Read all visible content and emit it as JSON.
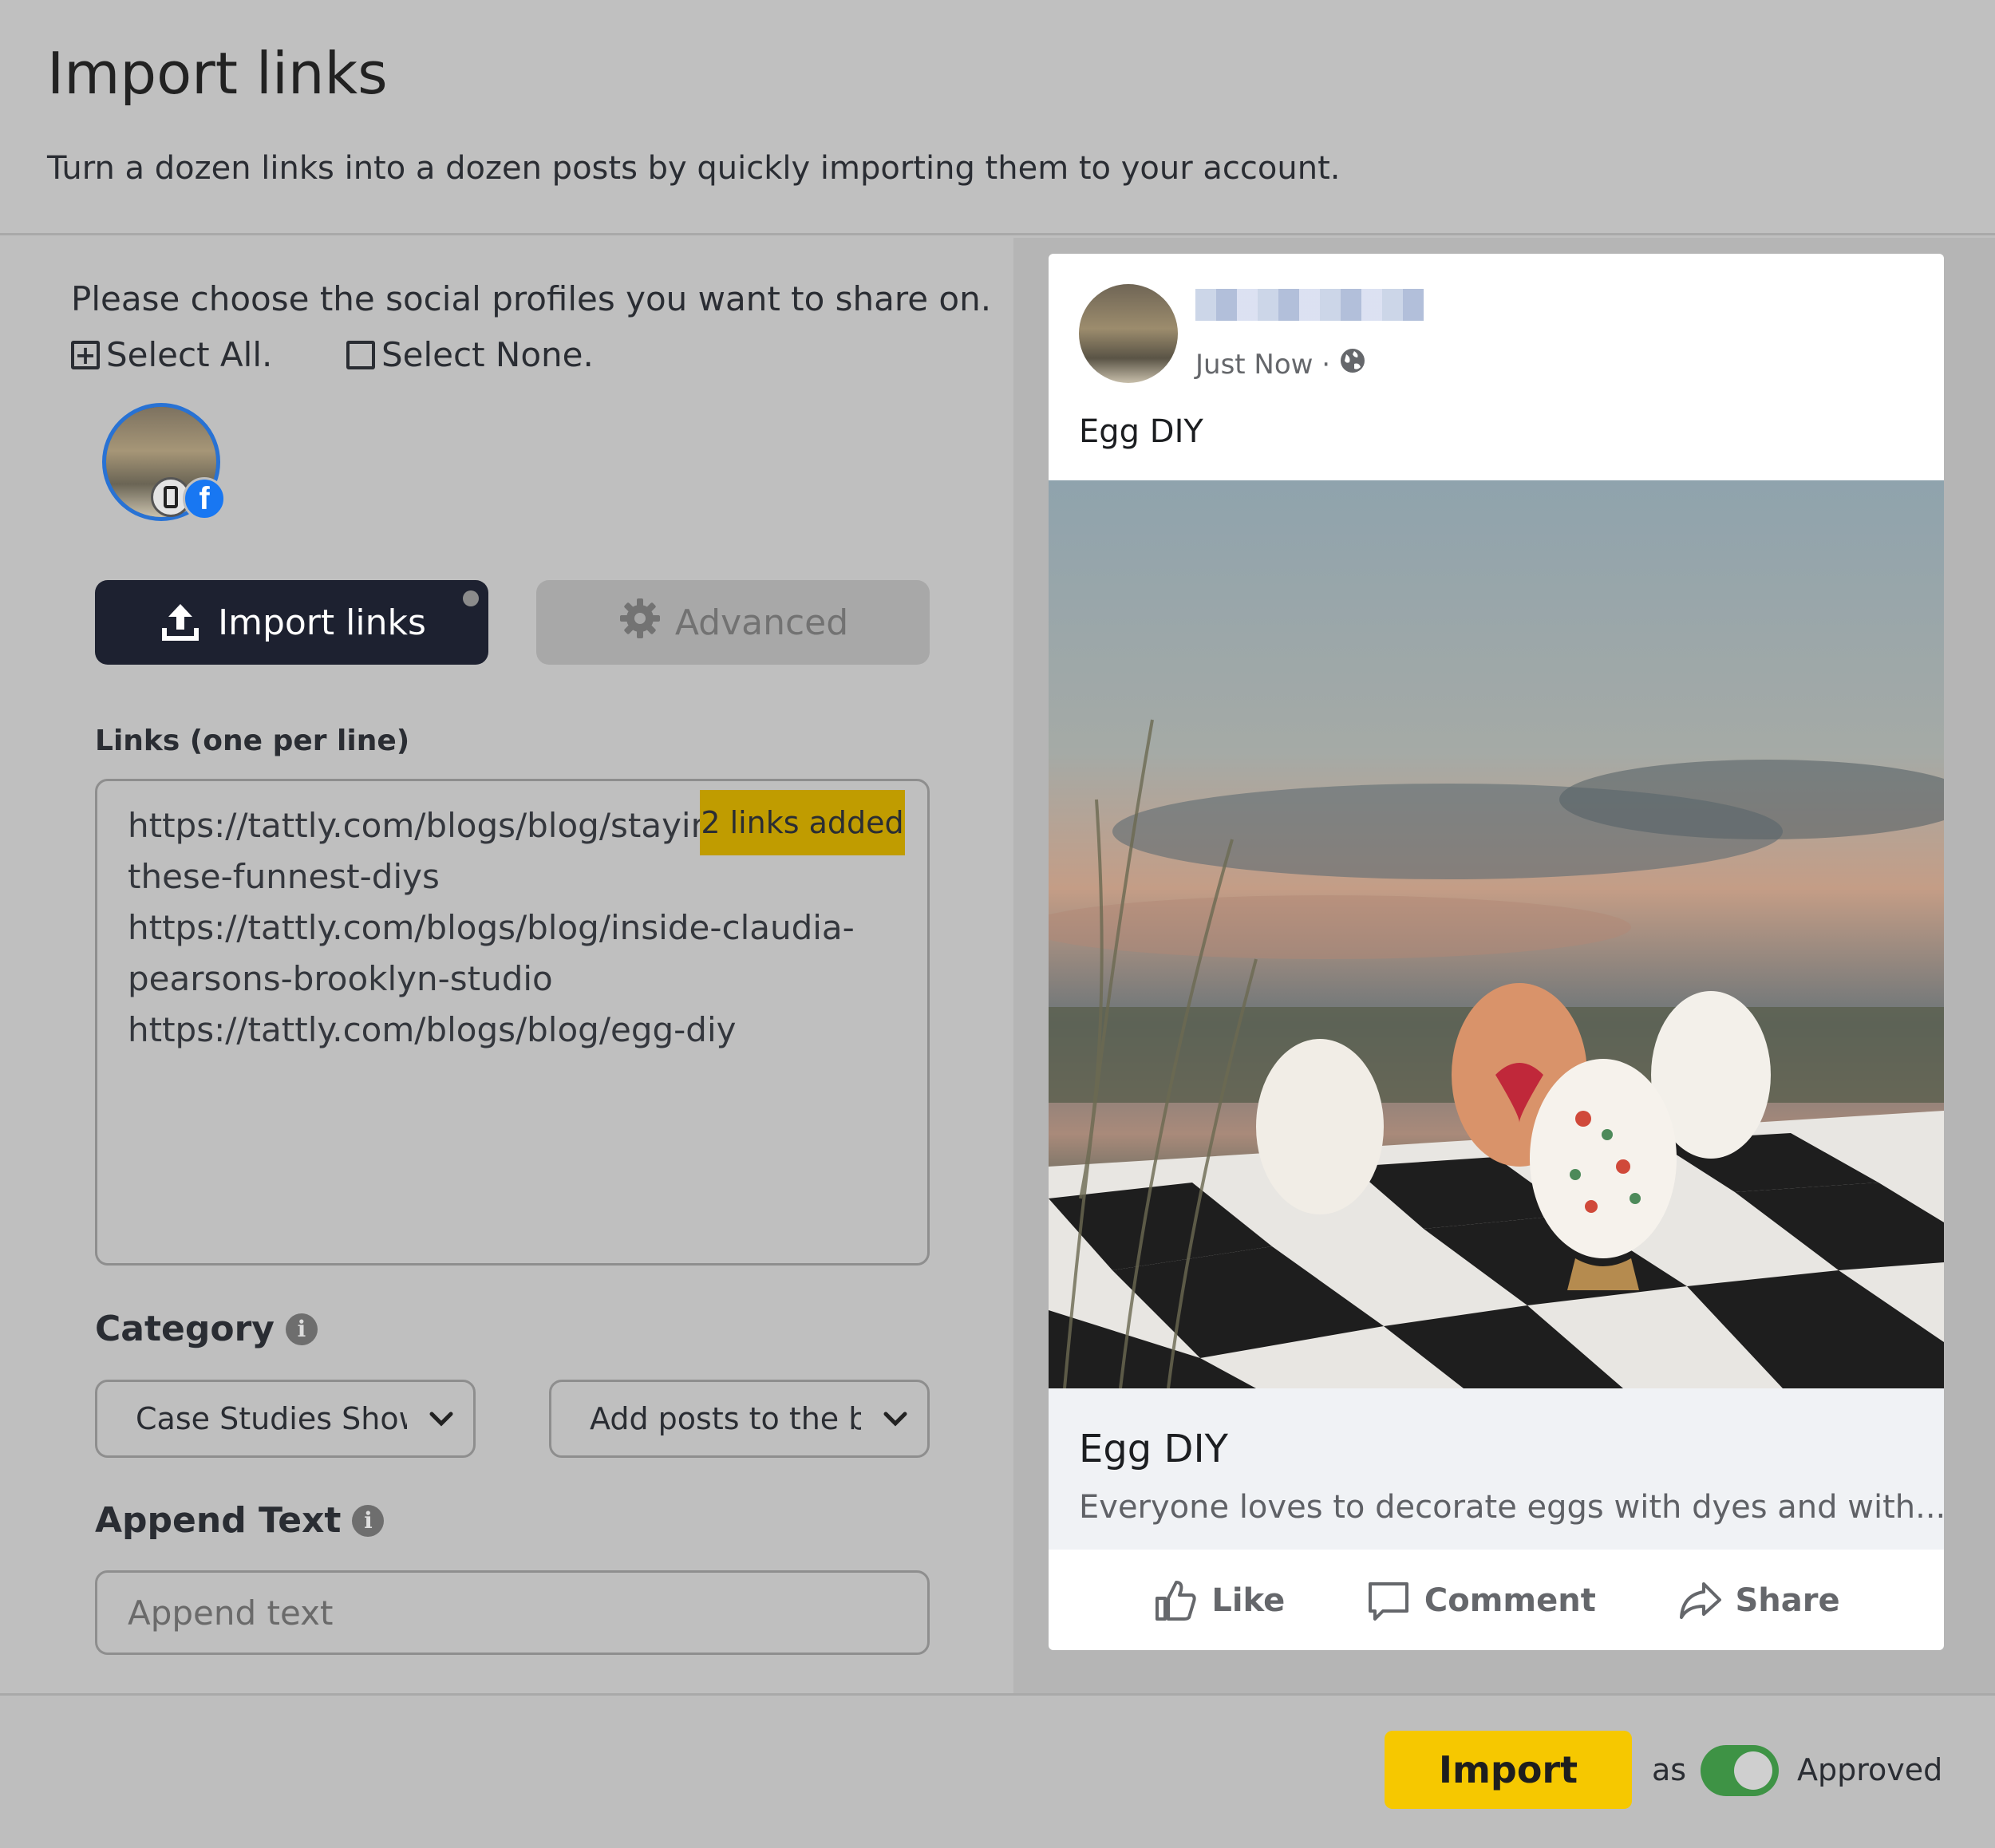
{
  "header": {
    "title": "Import links",
    "subtitle": "Turn a dozen links into a dozen posts by quickly importing them to your account."
  },
  "profiles": {
    "prompt": "Please choose the social profiles you want to share on.",
    "select_all": "Select All.",
    "select_none": "Select None."
  },
  "tabs": {
    "import_links": "Import links",
    "advanced": "Advanced"
  },
  "links": {
    "label": "Links (one per line)",
    "lines": [
      "https://tattly.com/blogs/blog/staying-",
      "these-funnest-diys",
      "https://tattly.com/blogs/blog/inside-claudia-",
      "pearsons-brooklyn-studio",
      "https://tattly.com/blogs/blog/egg-diy"
    ],
    "badge": "2 links added"
  },
  "category": {
    "label": "Category",
    "selected": "Case Studies Showcase",
    "position_selected": "Add posts to the bottom"
  },
  "append": {
    "label": "Append Text",
    "placeholder": "Append text"
  },
  "preview": {
    "time": "Just Now ·",
    "post_text": "Egg DIY",
    "link_title": "Egg DIY",
    "link_desc": "Everyone loves to decorate eggs with dyes and with...",
    "actions": {
      "like": "Like",
      "comment": "Comment",
      "share": "Share"
    }
  },
  "footer": {
    "import_label": "Import",
    "as_label": "as",
    "status_label": "Approved",
    "toggle_on": true
  },
  "colors": {
    "primary_dark": "#1d2130",
    "import_yellow": "#f6c800",
    "badge_gold": "#c09c00",
    "toggle_green": "#3e9345",
    "facebook_blue": "#1877f2"
  }
}
